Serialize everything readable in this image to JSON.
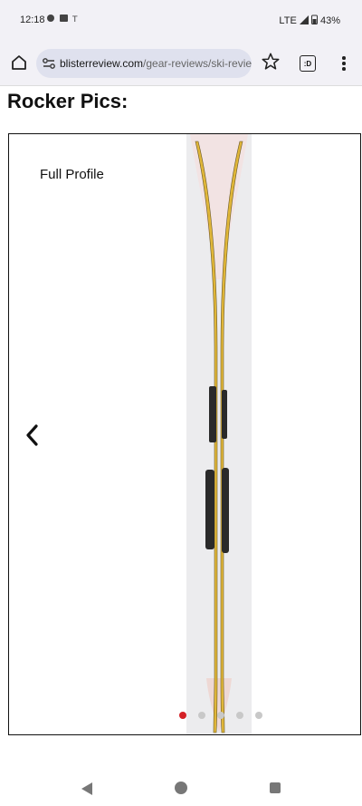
{
  "status": {
    "time": "12:18",
    "network": "LTE",
    "battery": "43%"
  },
  "browser": {
    "url_host": "blisterreview.com",
    "url_path": "/gear-reviews/ski-revie",
    "tabs_label": ":D"
  },
  "page": {
    "heading": "Rocker Pics:"
  },
  "slider": {
    "caption": "Full Profile",
    "dots": [
      {
        "active": true,
        "color": "#d42026"
      },
      {
        "active": false,
        "color": "#c8c8c8"
      },
      {
        "active": false,
        "color": "#c8c8c8"
      },
      {
        "active": false,
        "color": "#c8c8c8"
      },
      {
        "active": false,
        "color": "#c8c8c8"
      }
    ]
  },
  "colors": {
    "ski_top": "#e0b638",
    "ski_sheet": "#f2e3e3",
    "binding": "#2a2a2a"
  },
  "icons": [
    "home-icon",
    "site-settings-icon",
    "star-icon",
    "tabs-icon",
    "menu-icon",
    "chevron-left-icon",
    "back-icon",
    "home-nav-icon",
    "recents-icon"
  ]
}
